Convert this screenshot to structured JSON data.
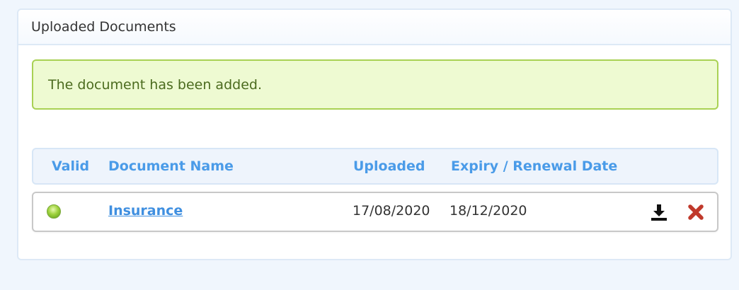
{
  "panel": {
    "title": "Uploaded Documents"
  },
  "alert": {
    "message": "The document has been added."
  },
  "table": {
    "columns": {
      "valid": "Valid",
      "name": "Document Name",
      "uploaded": "Uploaded",
      "expiry": "Expiry / Renewal Date"
    },
    "rows": [
      {
        "valid_status": "valid",
        "name": "Insurance",
        "uploaded": "17/08/2020",
        "expiry": "18/12/2020",
        "actions": [
          "download-icon",
          "delete-icon"
        ]
      }
    ]
  },
  "colors": {
    "page_bg": "#f0f6fd",
    "header_text": "#4a9be8",
    "link": "#3f8fe0",
    "alert_bg": "#eefad2",
    "alert_border": "#a9d154",
    "alert_text": "#4b6b1e",
    "delete": "#c0392b",
    "status_valid": "#8cc63f"
  }
}
